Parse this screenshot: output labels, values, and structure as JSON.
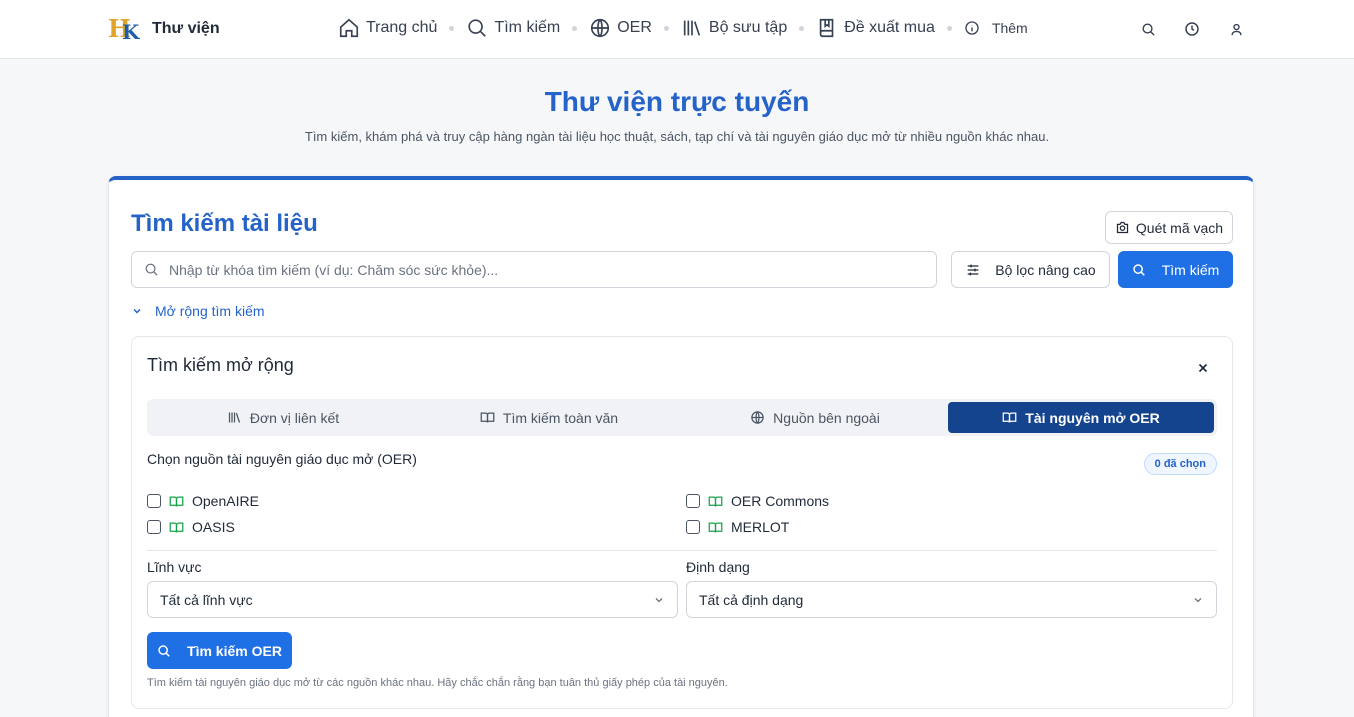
{
  "header": {
    "brand_name": "Thư viện",
    "brand_logo_letters": "HK",
    "nav": [
      {
        "label": "Trang chủ",
        "icon": "home-icon"
      },
      {
        "label": "Tìm kiếm",
        "icon": "search-icon"
      },
      {
        "label": "OER",
        "icon": "globe-icon"
      },
      {
        "label": "Bộ sưu tập",
        "icon": "library-icon"
      },
      {
        "label": "Đề xuất mua",
        "icon": "book-icon"
      },
      {
        "label": "Thêm",
        "icon": "info-icon"
      }
    ],
    "right_icons": [
      "search-icon",
      "history-icon",
      "user-icon"
    ]
  },
  "hero": {
    "title": "Thư viện trực tuyến",
    "subtitle": "Tìm kiếm, khám phá và truy cập hàng ngàn tài liệu học thuật, sách, tạp chí và tài nguyên giáo dục mở từ nhiều nguồn khác nhau."
  },
  "search_card": {
    "title": "Tìm kiếm tài liệu",
    "barcode_label": "Quét mã vạch",
    "search_placeholder": "Nhập từ khóa tìm kiếm (ví dụ: Chăm sóc sức khỏe)...",
    "search_value": "",
    "advanced_filter_label": "Bộ lọc nâng cao",
    "search_button_label": "Tìm kiếm",
    "expand_label": "Mở rộng tìm kiếm"
  },
  "extended": {
    "title": "Tìm kiếm mở rộng",
    "tabs": [
      {
        "label": "Đơn vị liên kết",
        "icon": "library-icon",
        "active": false
      },
      {
        "label": "Tìm kiếm toàn văn",
        "icon": "book-open-icon",
        "active": false
      },
      {
        "label": "Nguồn bên ngoài",
        "icon": "globe-icon",
        "active": false
      },
      {
        "label": "Tài nguyên mở OER",
        "icon": "book-open-icon",
        "active": true
      }
    ],
    "sources_label": "Chọn nguồn tài nguyên giáo dục mở (OER)",
    "selected_badge": "0 đã chọn",
    "sources": [
      {
        "label": "OpenAIRE",
        "checked": false
      },
      {
        "label": "OER Commons",
        "checked": false
      },
      {
        "label": "OASIS",
        "checked": false
      },
      {
        "label": "MERLOT",
        "checked": false
      }
    ],
    "field_label": "Lĩnh vực",
    "field_value": "Tất cả lĩnh vực",
    "format_label": "Định dạng",
    "format_value": "Tất cả định dạng",
    "oer_button_label": "Tìm kiếm OER",
    "note": "Tìm kiếm tài nguyên giáo dục mở từ các nguồn khác nhau. Hãy chắc chắn rằng bạn tuân thủ giấy phép của tài nguyên."
  },
  "colors": {
    "accent": "#2563c9",
    "primary_button": "#1f6fe5",
    "active_tab": "#15448f",
    "source_icon": "#16a34a"
  }
}
